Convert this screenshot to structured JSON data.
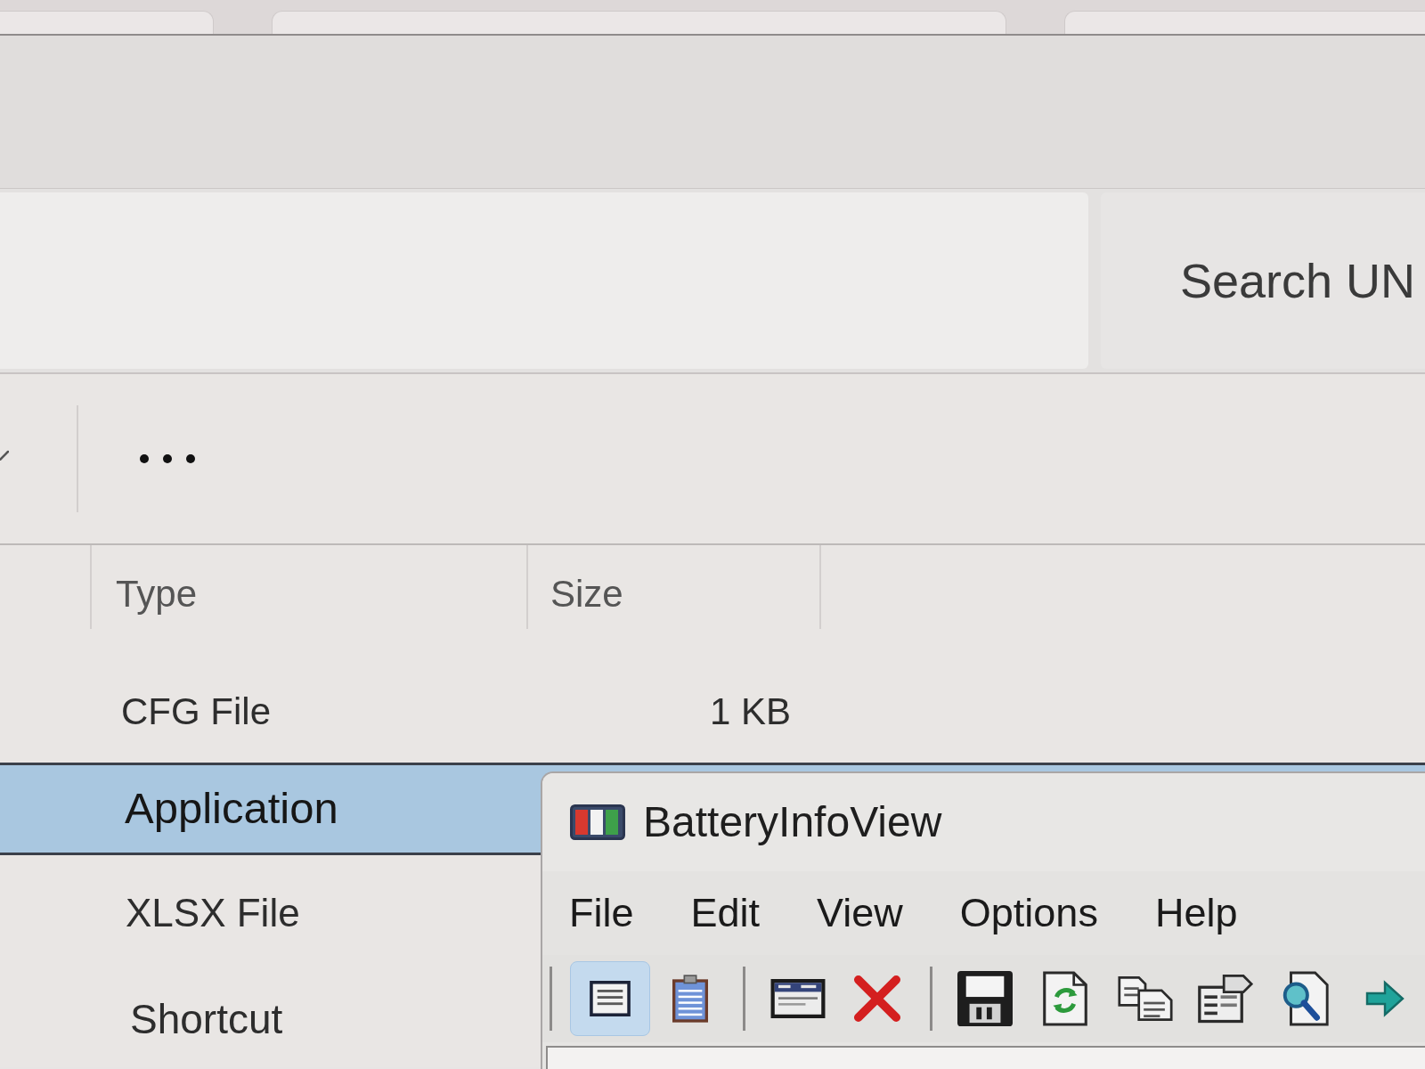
{
  "explorer": {
    "search": {
      "placeholder": "Search UN"
    },
    "columns": [
      {
        "label": "Type"
      },
      {
        "label": "Size"
      }
    ],
    "rows": [
      {
        "type": "CFG File",
        "size": "1 KB",
        "selected": false
      },
      {
        "type": "Application",
        "selected": true
      },
      {
        "type": "XLSX File",
        "selected": false
      },
      {
        "type": "Shortcut",
        "selected": false
      }
    ]
  },
  "app_window": {
    "title": "BatteryInfoView",
    "menu": [
      "File",
      "Edit",
      "View",
      "Options",
      "Help"
    ],
    "toolbar": [
      {
        "kind": "separator"
      },
      {
        "kind": "button",
        "selected": true
      },
      {
        "kind": "button",
        "selected": false
      },
      {
        "kind": "separator"
      },
      {
        "kind": "button",
        "selected": false
      },
      {
        "kind": "button",
        "selected": false
      },
      {
        "kind": "separator"
      },
      {
        "kind": "button",
        "selected": false
      },
      {
        "kind": "button",
        "selected": false
      },
      {
        "kind": "button",
        "selected": false
      },
      {
        "kind": "button",
        "selected": false
      },
      {
        "kind": "button",
        "selected": false
      },
      {
        "kind": "button",
        "selected": false
      }
    ]
  }
}
